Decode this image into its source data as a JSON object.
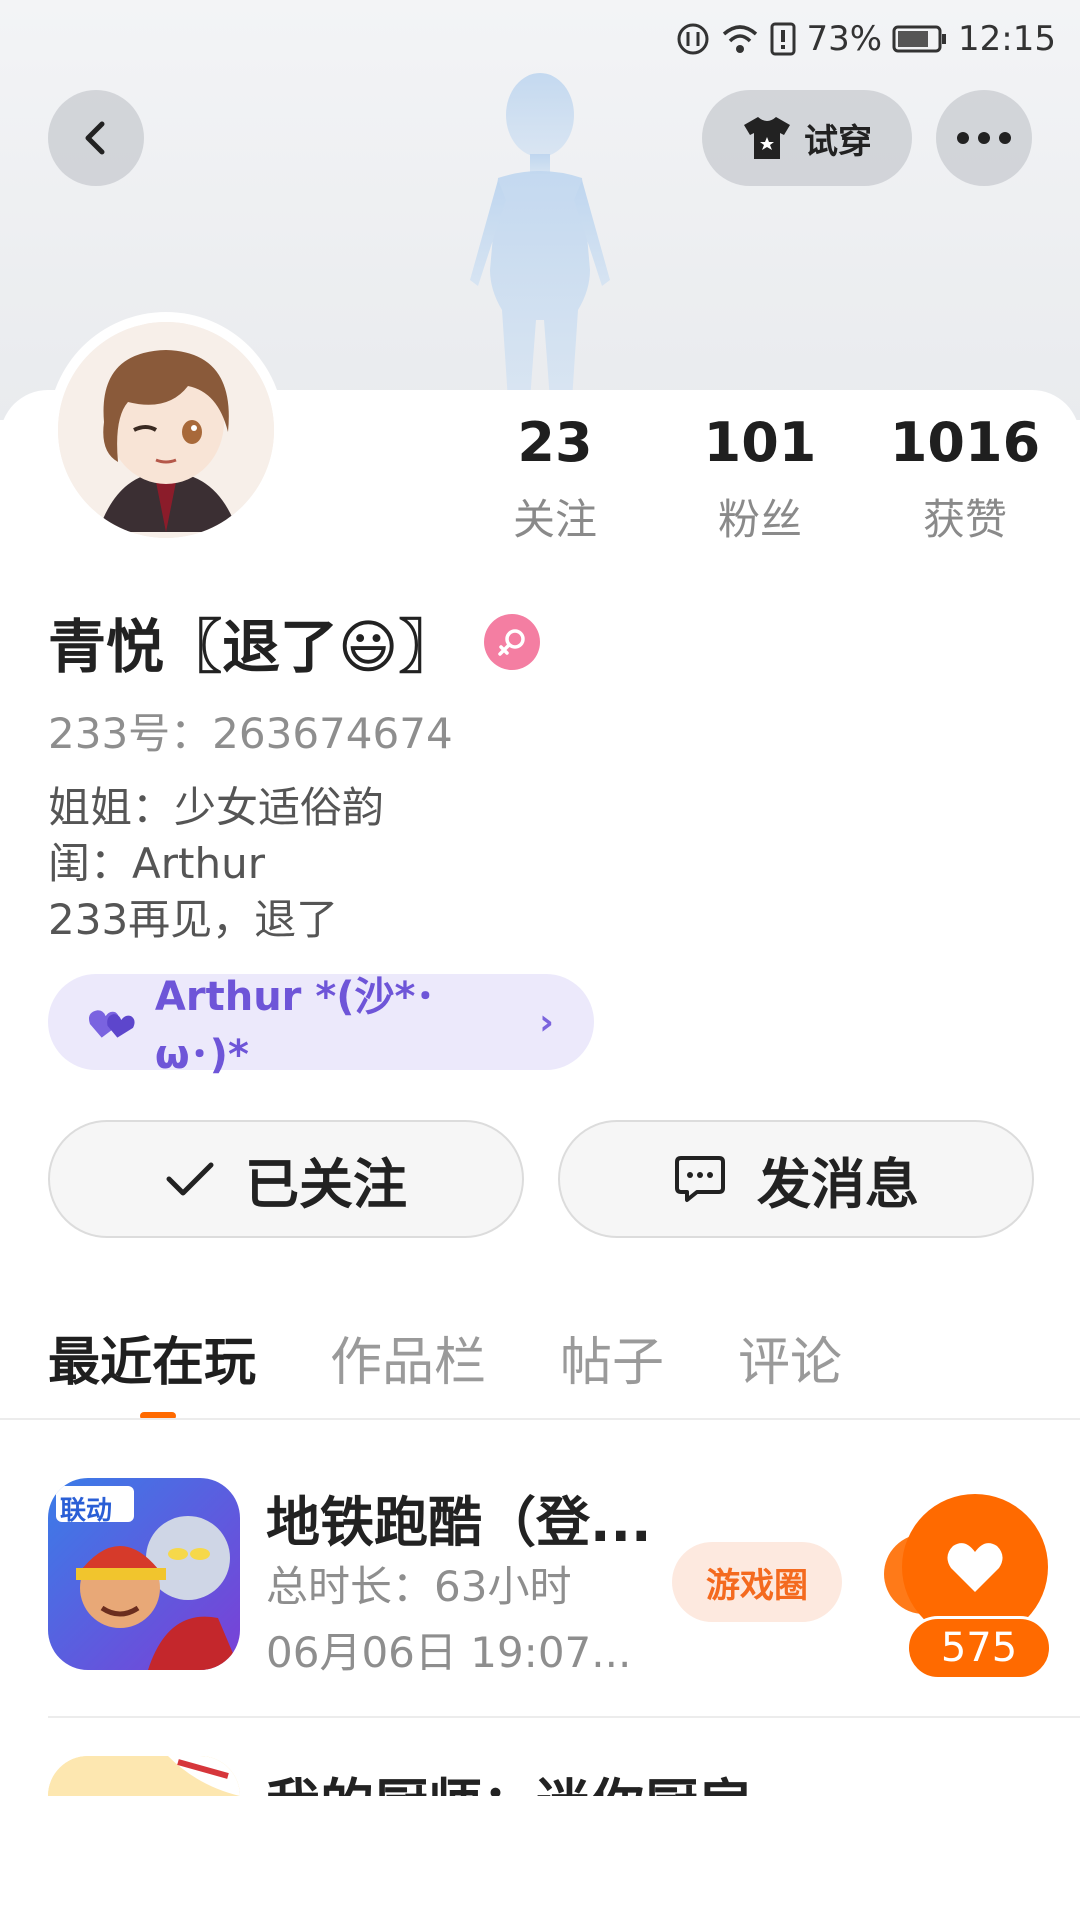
{
  "status_bar": {
    "battery": "73%",
    "time": "12:15"
  },
  "header": {
    "tryon_label": "试穿"
  },
  "stats": [
    {
      "num": "23",
      "label": "关注"
    },
    {
      "num": "101",
      "label": "粉丝"
    },
    {
      "num": "1016",
      "label": "获赞"
    }
  ],
  "profile": {
    "name": "青悦〖退了😃〗",
    "uid": "233号：263674674",
    "bio": [
      "姐姐：少女适俗韵",
      "闺：Arthur",
      "233再见，退了"
    ],
    "cp_label": "Arthur *(沙*･ω･)*"
  },
  "actions": {
    "follow_label": "已关注",
    "message_label": "发消息"
  },
  "tabs": [
    "最近在玩",
    "作品栏",
    "帖子",
    "评论"
  ],
  "games": [
    {
      "title": "地铁跑酷（登...",
      "duration": "总时长：63小时",
      "last_played": "06月06日 19:07...",
      "circle_label": "游戏圈",
      "likes": "575",
      "icon_text": "联动"
    },
    {
      "title": "我的厨师：迷你厨房"
    }
  ],
  "colors": {
    "accent": "#ff6a00",
    "cp_purple": "#6e55d8",
    "gender_pink": "#f47ea2"
  }
}
